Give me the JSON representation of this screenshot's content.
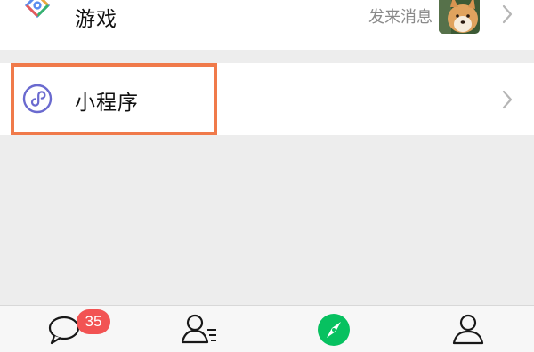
{
  "rows": {
    "games": {
      "label": "游戏",
      "note": "发来消息",
      "icon": "games-diamond-icon",
      "thumbnail": "shiba-dog-avatar"
    },
    "mini_programs": {
      "label": "小程序",
      "icon": "mini-program-icon"
    }
  },
  "tabbar": {
    "tabs": [
      {
        "name": "chats",
        "icon": "chat-bubble-icon",
        "badge": "35"
      },
      {
        "name": "contacts",
        "icon": "contacts-icon"
      },
      {
        "name": "discover",
        "icon": "compass-icon",
        "active": true
      },
      {
        "name": "me",
        "icon": "person-icon"
      }
    ]
  },
  "colors": {
    "active": "#07c160",
    "badge": "#f25353",
    "highlight": "#f07a4a",
    "mini_program_icon": "#6a6acf"
  }
}
